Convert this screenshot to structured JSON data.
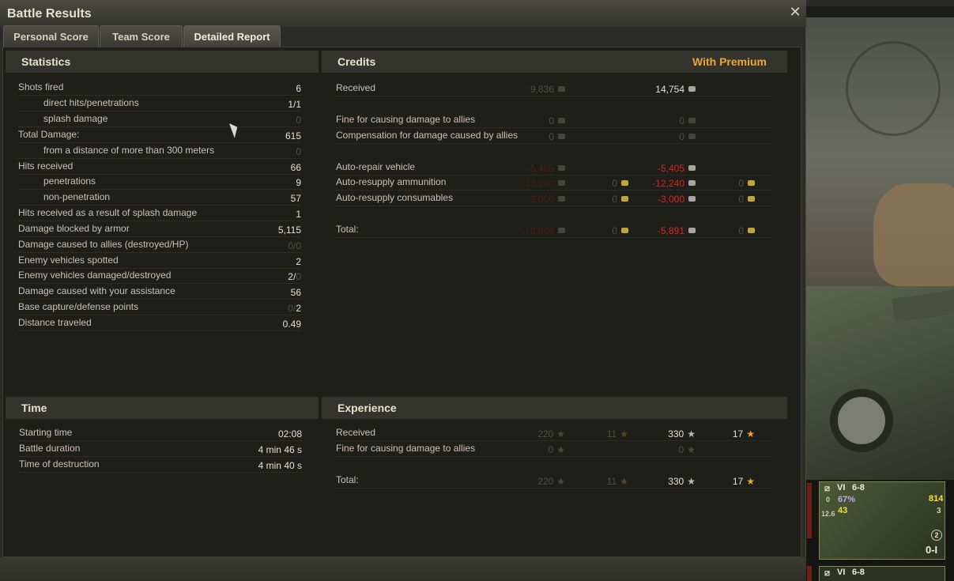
{
  "window": {
    "title": "Battle Results",
    "close_symbol": "✕"
  },
  "tabs": [
    {
      "label": "Personal Score",
      "active": false
    },
    {
      "label": "Team Score",
      "active": false
    },
    {
      "label": "Detailed Report",
      "active": true
    }
  ],
  "statistics": {
    "heading": "Statistics",
    "rows": [
      {
        "label": "Shots fired",
        "value": "6"
      },
      {
        "label": "direct hits/penetrations",
        "value": "1/1"
      },
      {
        "label": "splash damage",
        "value": "0"
      },
      {
        "label": "Total Damage:",
        "value": "615"
      },
      {
        "label": "from a distance of more than 300 meters",
        "value": "0"
      },
      {
        "label": "Hits received",
        "value": "66"
      },
      {
        "label": "penetrations",
        "value": "9"
      },
      {
        "label": "non-penetration",
        "value": "57"
      },
      {
        "label": "Hits received as a result of splash damage",
        "value": "1"
      },
      {
        "label": "Damage blocked by armor",
        "value": "5,115"
      },
      {
        "label": "Damage caused to allies (destroyed/HP)",
        "value": "0/0"
      },
      {
        "label": "Enemy vehicles spotted",
        "value": "2"
      },
      {
        "label": "Enemy vehicles damaged/destroyed",
        "value_a": "2/",
        "value_b": "0"
      },
      {
        "label": "Damage caused with your assistance",
        "value": "56"
      },
      {
        "label": "Base capture/defense points",
        "value_a": "0/",
        "value_b": "2"
      },
      {
        "label": "Distance traveled",
        "value": "0.49"
      }
    ]
  },
  "credits": {
    "heading": "Credits",
    "premium_heading": "With Premium",
    "rows": [
      {
        "label": "Received",
        "base": "9,836",
        "premium": "14,754"
      },
      {
        "label": "Fine for causing damage to allies",
        "base": "0",
        "premium": "0"
      },
      {
        "label": "Compensation for damage caused by allies",
        "base": "0",
        "premium": "0"
      },
      {
        "label": "Auto-repair vehicle",
        "base": "-5,405",
        "premium": "-5,405"
      },
      {
        "label": "Auto-resupply ammunition",
        "base": "-12,240",
        "base_gold": "0",
        "premium": "-12,240",
        "premium_gold": "0"
      },
      {
        "label": "Auto-resupply consumables",
        "base": "-3,000",
        "base_gold": "0",
        "premium": "-3,000",
        "premium_gold": "0"
      },
      {
        "label": "Total:",
        "base": "-10,809",
        "base_gold": "0",
        "premium": "-5,891",
        "premium_gold": "0"
      }
    ]
  },
  "time": {
    "heading": "Time",
    "rows": [
      {
        "label": "Starting time",
        "value": "02:08"
      },
      {
        "label": "Battle duration",
        "value": "4 min 46 s"
      },
      {
        "label": "Time of destruction",
        "value": "4 min 40 s"
      }
    ]
  },
  "experience": {
    "heading": "Experience",
    "rows": [
      {
        "label": "Received",
        "base": "220",
        "base_free": "11",
        "premium": "330",
        "premium_free": "17"
      },
      {
        "label": "Fine for causing damage to allies",
        "base": "0",
        "premium": "0"
      },
      {
        "label": "Total:",
        "base": "220",
        "base_free": "11",
        "premium": "330",
        "premium_free": "17"
      }
    ]
  },
  "carousel": {
    "card1": {
      "tier": "VI",
      "level_range": "6-8",
      "crew": "67%",
      "battles": "43",
      "damage": "814",
      "left_stat_a": "0",
      "left_stat_b": "12.6",
      "right_stat": "3",
      "mastery": "2",
      "name": "0-I"
    },
    "card2": {
      "tier": "VI",
      "level_range": "6-8"
    }
  },
  "colors": {
    "premium": "#f0a433",
    "negative": "#d3281e",
    "text": "#c8c4b0"
  }
}
